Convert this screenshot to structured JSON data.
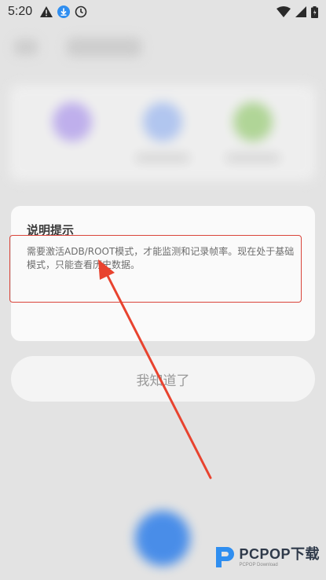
{
  "status_bar": {
    "time": "5:20",
    "left_icons": [
      "warning-icon",
      "download-icon",
      "clock-icon"
    ],
    "right_icons": [
      "wifi-icon",
      "signal-icon",
      "battery-icon"
    ]
  },
  "dialog": {
    "title": "说明提示",
    "message": "需要激活ADB/ROOT模式，才能监测和记录帧率。现在处于基础模式，只能查看历史数据。",
    "confirm_label": "我知道了"
  },
  "annotation": {
    "box_color": "#d9443a",
    "arrow_color": "#e8432f"
  },
  "watermark": {
    "main": "PCPOP下载",
    "sub": "PCPOP Download"
  }
}
